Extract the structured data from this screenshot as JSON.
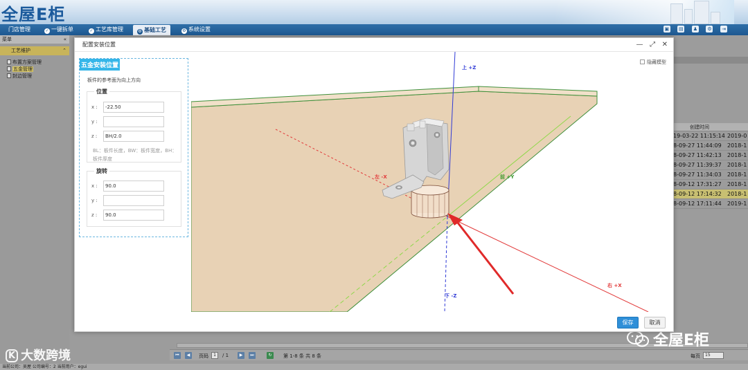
{
  "app": {
    "logo": "全屋E柜"
  },
  "nav": {
    "items": [
      {
        "label": "门店管理",
        "icon": "store-icon"
      },
      {
        "label": "一键拆单",
        "icon": "check-circle-icon"
      },
      {
        "label": "工艺库管理",
        "icon": "check-circle-icon"
      },
      {
        "label": "基础工艺",
        "icon": "gear-circle-icon",
        "active": true
      },
      {
        "label": "系统设置",
        "icon": "settings-circle-icon"
      }
    ]
  },
  "sidebar": {
    "header": "菜单",
    "collapse": "«",
    "section": "工艺维护",
    "section_toggle": "⌃",
    "items": [
      {
        "label": "布置方案管理"
      },
      {
        "label": "五金管理",
        "selected": true
      },
      {
        "label": "封边管理"
      }
    ]
  },
  "background_table": {
    "col1_header": "创建时间",
    "col2_header": "",
    "rows": [
      {
        "c1": "19-03-22 11:15:14",
        "c2": "2019-0"
      },
      {
        "c1": "8-09-27 11:44:09",
        "c2": "2018-1"
      },
      {
        "c1": "8-09-27 11:42:13",
        "c2": "2018-1"
      },
      {
        "c1": "8-09-27 11:39:37",
        "c2": "2018-1"
      },
      {
        "c1": "8-09-27 11:34:03",
        "c2": "2018-1"
      },
      {
        "c1": "8-09-12 17:31:27",
        "c2": "2018-1"
      },
      {
        "c1": "8-09-12 17:14:32",
        "c2": "2018-1",
        "highlight": true
      },
      {
        "c1": "8-09-12 17:11:44",
        "c2": "2019-1"
      }
    ]
  },
  "pager": {
    "page_label": "页码",
    "page_value": "1",
    "page_total": "/ 1",
    "range_text": "第 1-8 条   共 8 条",
    "per_page_label": "每页",
    "per_page_value": "15"
  },
  "statusbar": {
    "text": "当前公司：吴屋   公司编号：2   当前用户：egui"
  },
  "watermark": {
    "left": "大数跨境",
    "left_badge": "K",
    "right": "全屋E柜"
  },
  "modal": {
    "title": "配置安装位置",
    "ctrl_minimize": "—",
    "ctrl_maximize": "⤢",
    "ctrl_close": "✕",
    "panel_title": "五金安装位置",
    "panel_subtitle": "板件的参考面为向上方向",
    "position": {
      "legend": "位置",
      "x_label": "x :",
      "x_value": "-22.50",
      "y_label": "y :",
      "y_value": "",
      "z_label": "z :",
      "z_value": "BH/2.0",
      "hint": "BL：板件长度，BW：板件宽度，BH：板件厚度"
    },
    "rotation": {
      "legend": "旋转",
      "x_label": "x :",
      "x_value": "90.0",
      "y_label": "y :",
      "y_value": "",
      "z_label": "z :",
      "z_value": "90.0"
    },
    "hide_model_label": "隐藏模型",
    "axes": {
      "up": "上 +Z",
      "down": "下 -Z",
      "left": "左 -X",
      "right": "右 +X",
      "front": "前 +Y"
    },
    "save": "保存",
    "cancel": "取消"
  },
  "colors": {
    "board": "#e8d2b5",
    "board_edge": "#3f8f3a",
    "axis_z": "#2f3ad6",
    "axis_x": "#e23a3a",
    "axis_y": "#8fd84a",
    "primary": "#2f8fd8",
    "nav_bg": "#1d5891"
  }
}
